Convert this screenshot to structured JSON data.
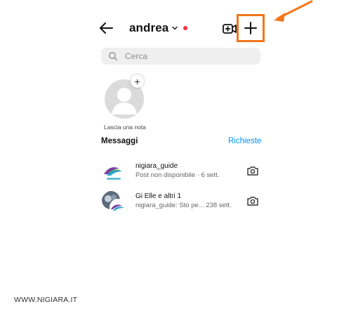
{
  "header": {
    "username": "andrea",
    "back_icon": "arrow-left-icon",
    "new_video_icon": "video-add-icon",
    "new_message_icon": "plus-icon",
    "status_dot_color": "#ff3040",
    "highlight_color": "#f2761c"
  },
  "search": {
    "placeholder": "Cerca"
  },
  "note": {
    "label": "Lascia una nota",
    "add_icon": "+"
  },
  "messages": {
    "title": "Messaggi",
    "requests_label": "Richieste",
    "threads": [
      {
        "name": "nigiara_guide",
        "preview": "Post non disponibile · 6 sett.",
        "action_icon": "camera-icon"
      },
      {
        "name": "Gi Elle e altri 1",
        "preview": "nigiara_guide: Sto pe... 238 sett.",
        "action_icon": "camera-icon"
      }
    ]
  },
  "watermark": "WWW.NIGIARA.IT"
}
